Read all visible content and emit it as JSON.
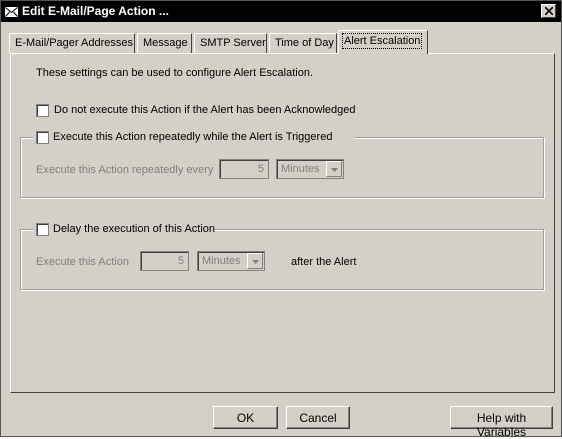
{
  "window": {
    "title": "Edit E-Mail/Page Action ..."
  },
  "tabs": [
    {
      "label": "E-Mail/Pager Addresses"
    },
    {
      "label": "Message"
    },
    {
      "label": "SMTP Server"
    },
    {
      "label": "Time of Day"
    },
    {
      "label": "Alert Escalation",
      "active": true
    }
  ],
  "panel": {
    "intro": "These settings can be used to configure Alert Escalation.",
    "ack_checkbox": {
      "label": "Do not execute this Action if the Alert has been Acknowledged",
      "checked": false
    },
    "repeat_group": {
      "checkbox_label": "Execute this Action repeatedly while the Alert is Triggered",
      "checked": false,
      "row_label": "Execute this Action repeatedly every",
      "value": "5",
      "unit": "Minutes"
    },
    "delay_group": {
      "checkbox_label": "Delay the execution of this Action",
      "checked": false,
      "row_label": "Execute this Action",
      "value": "5",
      "unit": "Minutes",
      "suffix": "after the Alert"
    }
  },
  "buttons": {
    "ok": "OK",
    "cancel": "Cancel",
    "help": "Help with Variables"
  },
  "icons": {
    "title": "envelope-icon",
    "close": "close-icon",
    "dropdown": "chevron-down-icon"
  }
}
